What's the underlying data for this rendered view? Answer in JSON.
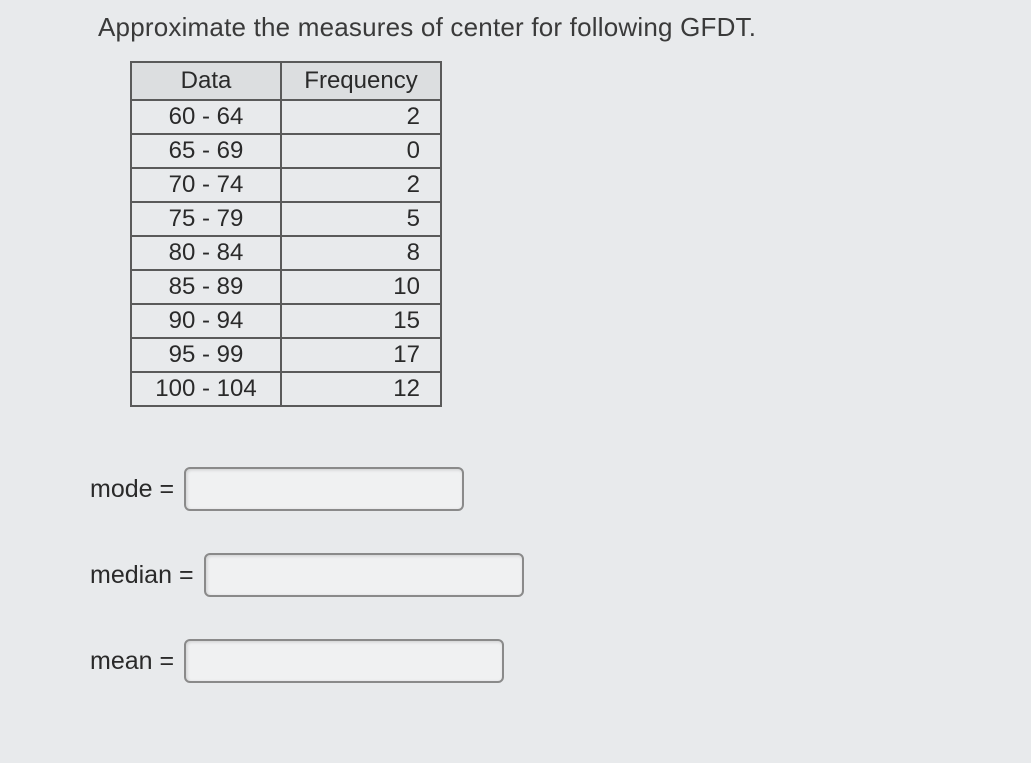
{
  "instruction": "Approximate the measures of center for following GFDT.",
  "table": {
    "headers": {
      "data": "Data",
      "frequency": "Frequency"
    },
    "rows": [
      {
        "data": "60 - 64",
        "frequency": "2"
      },
      {
        "data": "65 - 69",
        "frequency": "0"
      },
      {
        "data": "70 - 74",
        "frequency": "2"
      },
      {
        "data": "75 - 79",
        "frequency": "5"
      },
      {
        "data": "80 - 84",
        "frequency": "8"
      },
      {
        "data": "85 - 89",
        "frequency": "10"
      },
      {
        "data": "90 - 94",
        "frequency": "15"
      },
      {
        "data": "95 - 99",
        "frequency": "17"
      },
      {
        "data": "100 - 104",
        "frequency": "12"
      }
    ]
  },
  "answers": {
    "mode": {
      "label": "mode =",
      "value": ""
    },
    "median": {
      "label": "median =",
      "value": ""
    },
    "mean": {
      "label": "mean =",
      "value": ""
    }
  }
}
